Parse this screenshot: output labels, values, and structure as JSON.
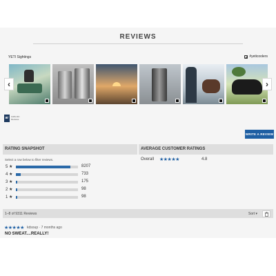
{
  "reviews_heading": "REVIEWS",
  "gallery": {
    "label": "YETI Sightings",
    "handle": "#yeticoolers",
    "thumbnails": [
      "photo-1",
      "photo-2",
      "photo-3",
      "photo-4",
      "photo-5",
      "photo-6",
      "photo-7"
    ]
  },
  "badge": {
    "logo": "ar",
    "text": "Authentic Reviews"
  },
  "write_review_label": "WRITE A REVIEW",
  "snapshot": {
    "heading": "RATING SNAPSHOT",
    "hint": "Select a row below to filter reviews.",
    "rows": [
      {
        "stars": "5 ★",
        "count": "8207",
        "fraction": 0.88
      },
      {
        "stars": "4 ★",
        "count": "733",
        "fraction": 0.08
      },
      {
        "stars": "3 ★",
        "count": "175",
        "fraction": 0.02
      },
      {
        "stars": "2 ★",
        "count": "98",
        "fraction": 0.011
      },
      {
        "stars": "1 ★",
        "count": "98",
        "fraction": 0.011
      }
    ]
  },
  "average": {
    "heading": "AVERAGE CUSTOMER RATINGS",
    "overall_label": "Overall",
    "stars": "★★★★★",
    "value": "4.8"
  },
  "list": {
    "count_text": "1–8 of 9311 Reviews",
    "sort_label": "Sort ▾"
  },
  "first_review": {
    "stars": "★★★★★",
    "meta": "kdsoup · 7 months ago",
    "title": "NO SWEAT....REALLY!"
  },
  "colors": {
    "accent": "#1e5fa3",
    "panel": "#f5f5f5",
    "header": "#dedede"
  }
}
